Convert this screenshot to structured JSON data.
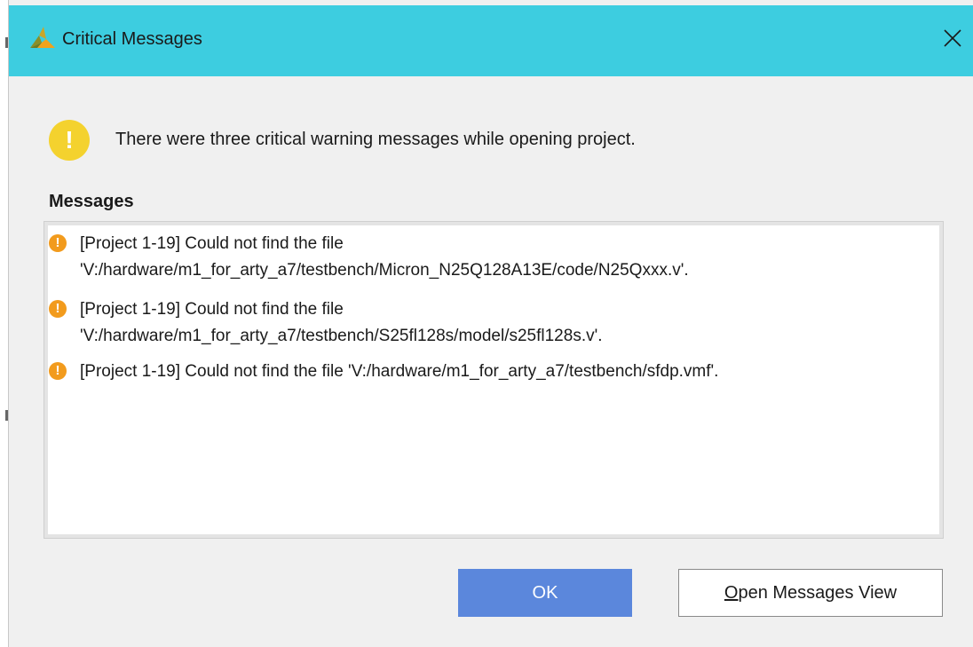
{
  "window": {
    "title": "Critical Messages",
    "title_bar_color": "#3dcde0",
    "logo_icon": "vivado-logo-icon",
    "close_glyph": "✕"
  },
  "intro": {
    "icon": "warning-icon",
    "icon_glyph": "!",
    "icon_color": "#f4d22e",
    "text": "There were three critical warning messages while opening project."
  },
  "messages": {
    "label": "Messages",
    "icon_color": "#f29b1d",
    "items": [
      {
        "icon": "critical-warning-icon",
        "glyph": "!",
        "text": "[Project 1-19] Could not find the file\n'V:/hardware/m1_for_arty_a7/testbench/Micron_N25Q128A13E/code/N25Qxxx.v'."
      },
      {
        "icon": "critical-warning-icon",
        "glyph": "!",
        "text": "[Project 1-19] Could not find the file\n'V:/hardware/m1_for_arty_a7/testbench/S25fl128s/model/s25fl128s.v'."
      },
      {
        "icon": "critical-warning-icon",
        "glyph": "!",
        "text": "[Project 1-19] Could not find the file 'V:/hardware/m1_for_arty_a7/testbench/sfdp.vmf'."
      }
    ]
  },
  "buttons": {
    "ok_label": "OK",
    "ok_color": "#5b87dc",
    "open_view_mnemonic": "O",
    "open_view_rest": "pen Messages View"
  }
}
